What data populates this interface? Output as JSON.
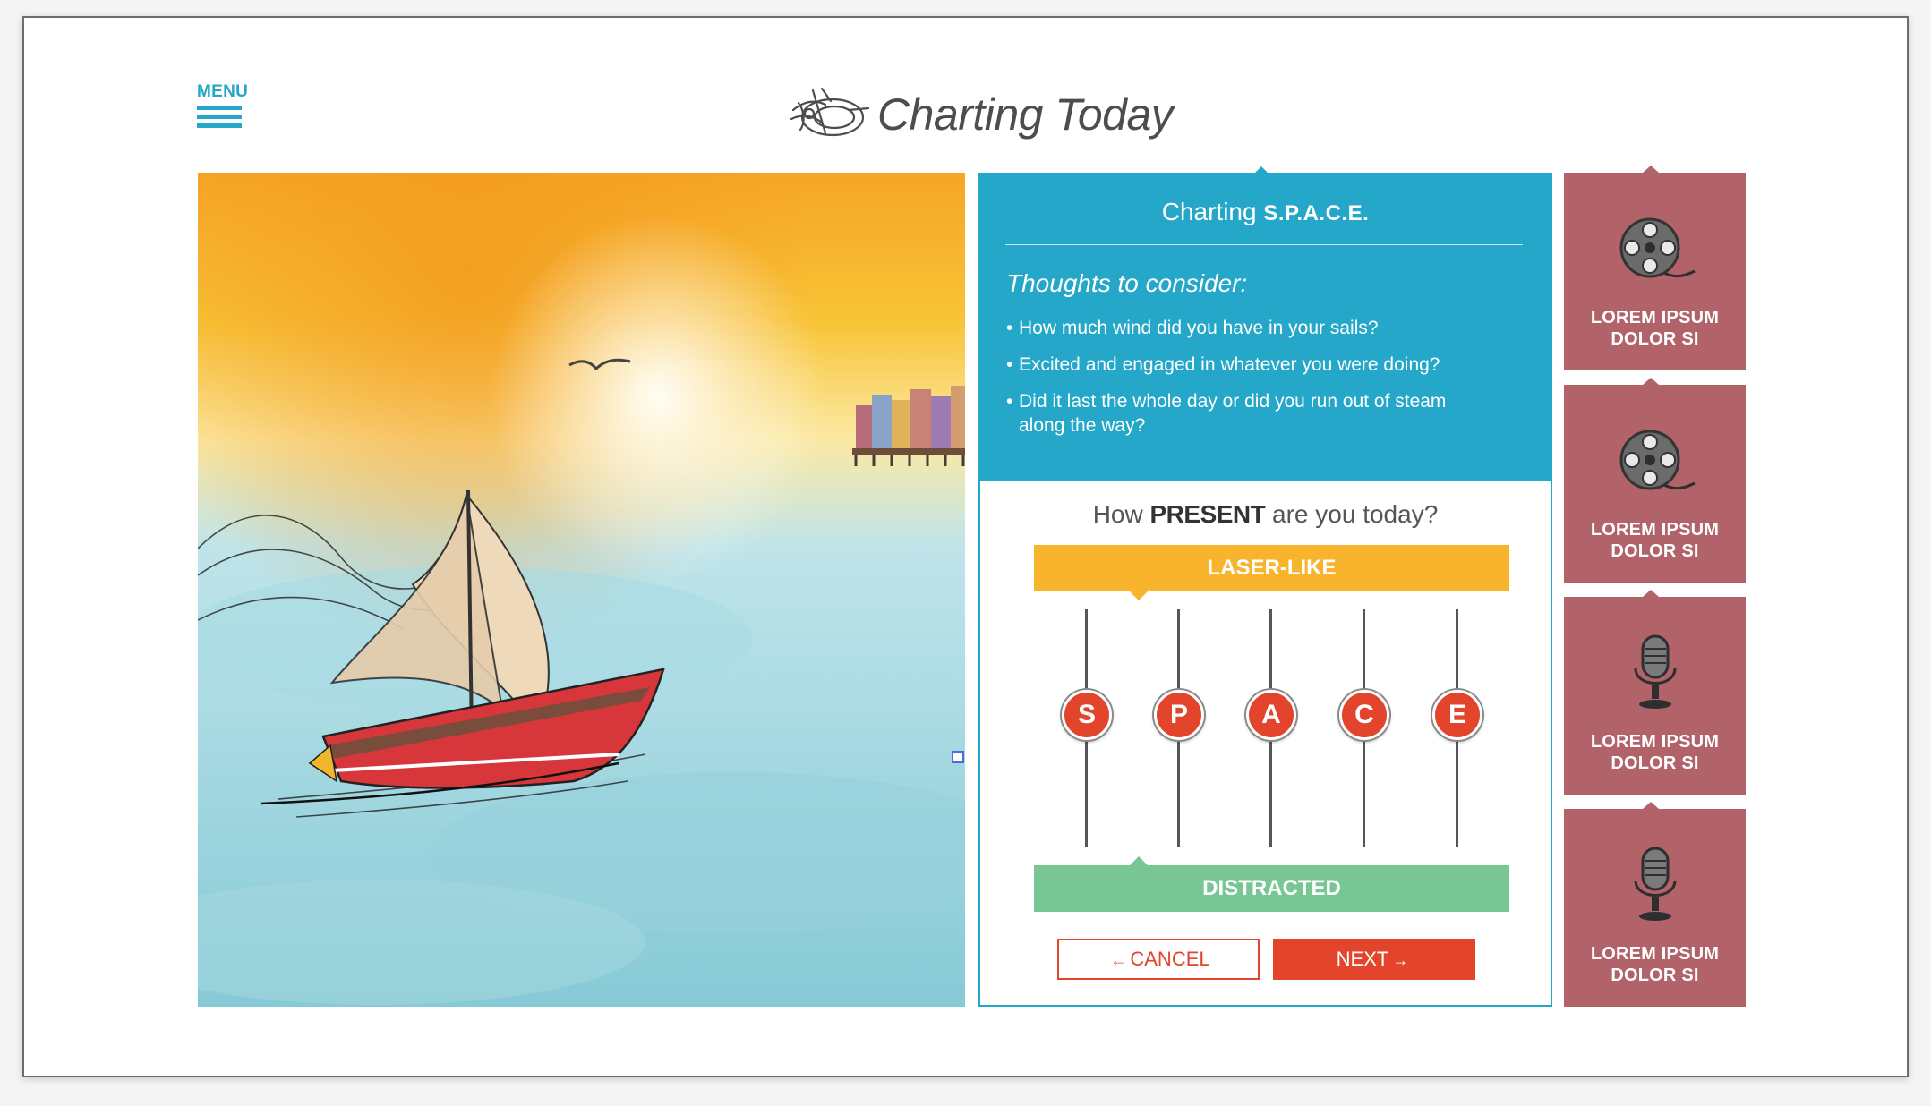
{
  "menu": {
    "label": "MENU",
    "icon": "hamburger-icon"
  },
  "header": {
    "brand": "Charting Today",
    "logo_icon": "compass-logo-icon"
  },
  "illustration": {
    "description_icon": "sailboat-illustration"
  },
  "info": {
    "title_prefix": "Charting",
    "title_bold": "S.P.A.C.E.",
    "thoughts_heading": "Thoughts to consider:",
    "bullets": [
      "How much wind did you have in your sails?",
      "Excited and engaged in whatever you were doing?",
      "Did it last the whole day or did you run out of steam along the way?"
    ]
  },
  "slider": {
    "question_prefix": "How",
    "question_bold": "PRESENT",
    "question_suffix": "are you today?",
    "top_label": "LASER-LIKE",
    "bottom_label": "DISTRACTED",
    "knobs": [
      {
        "letter": "S",
        "level": 0.5
      },
      {
        "letter": "P",
        "level": 0.5
      },
      {
        "letter": "A",
        "level": 0.5
      },
      {
        "letter": "C",
        "level": 0.5
      },
      {
        "letter": "E",
        "level": 0.5
      }
    ],
    "cancel_label": "CANCEL",
    "next_label": "NEXT"
  },
  "cards": [
    {
      "label_line1": "LOREM IPSUM",
      "label_line2": "DOLOR SI",
      "icon": "film-reel-icon"
    },
    {
      "label_line1": "LOREM IPSUM",
      "label_line2": "DOLOR SI",
      "icon": "film-reel-icon"
    },
    {
      "label_line1": "LOREM IPSUM",
      "label_line2": "DOLOR SI",
      "icon": "microphone-icon"
    },
    {
      "label_line1": "LOREM IPSUM",
      "label_line2": "DOLOR SI",
      "icon": "microphone-icon"
    }
  ],
  "colors": {
    "accent": "#25a7c9",
    "action": "#e2452b",
    "laser": "#f7b42c",
    "distracted": "#78c693",
    "card": "#b2636a"
  }
}
